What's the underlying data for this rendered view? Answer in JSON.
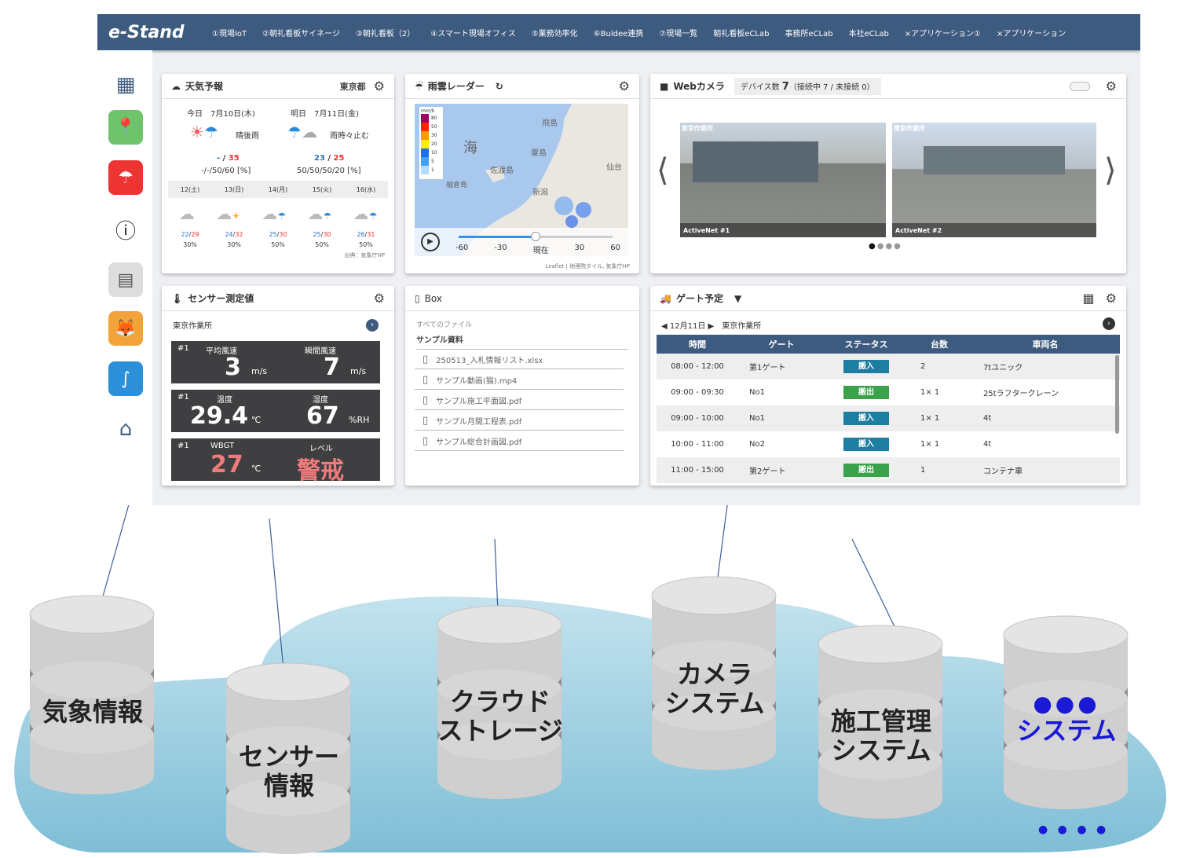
{
  "app": {
    "logo": "e-Stand",
    "nav": [
      "①現場IoT",
      "②朝礼看板サイネージ",
      "③朝礼看板（2）",
      "④スマート現場オフィス",
      "⑤業務効率化",
      "⑥Buldee連携",
      "⑦現場一覧",
      "朝礼看板eCLab",
      "事務所eCLab",
      "本社eCLab",
      "×アプリケーション①",
      "×アプリケーション"
    ]
  },
  "weather": {
    "title": "天気予報",
    "location": "東京都",
    "today_label": "今日",
    "today_date": "7月10日(木)",
    "today_cond": "晴後雨",
    "today_temp_lo": "-",
    "today_temp_hi": "35",
    "today_rain": "-/-/50/60 [%]",
    "tom_label": "明日",
    "tom_date": "7月11日(金)",
    "tom_cond": "雨時々止む",
    "tom_temp_lo": "23",
    "tom_temp_hi": "25",
    "tom_rain": "50/50/50/20 [%]",
    "days": [
      "12(土)",
      "13(日)",
      "14(月)",
      "15(火)",
      "16(水)"
    ],
    "week_temps": [
      [
        "22",
        "29"
      ],
      [
        "24",
        "32"
      ],
      [
        "25",
        "30"
      ],
      [
        "25",
        "30"
      ],
      [
        "26",
        "31"
      ]
    ],
    "week_rain": [
      "30%",
      "30%",
      "50%",
      "50%",
      "50%"
    ],
    "source": "出典：気象庁HP"
  },
  "radar": {
    "title": "雨雲レーダー",
    "sea": "海",
    "places": [
      "飛島",
      "粟島",
      "佐渡島",
      "新潟",
      "仙台",
      "舳倉島"
    ],
    "legend_unit": "mm/h",
    "legend_vals": [
      "80",
      "50",
      "30",
      "20",
      "10",
      "5",
      "1"
    ],
    "ticks": [
      "-60",
      "-30",
      "現在",
      "30",
      "60"
    ],
    "credit": "Leaflet | 地理院タイル, 気象庁HP"
  },
  "webcam": {
    "title": "Webカメラ",
    "devices_label": "デバイス数",
    "devices_count": "7",
    "devices_detail": "（接続中 7 / 未接続 0）",
    "cams": [
      {
        "site": "東京作業所",
        "name": "ActiveNet #1"
      },
      {
        "site": "東京作業所",
        "name": "ActiveNet #2"
      }
    ]
  },
  "sensor": {
    "title": "センサー測定値",
    "site": "東京作業所",
    "blocks": [
      {
        "tag": "#1",
        "l1": "平均風速",
        "v1": "3",
        "u1": "m/s",
        "l2": "瞬間風速",
        "v2": "7",
        "u2": "m/s"
      },
      {
        "tag": "#1",
        "l1": "温度",
        "v1": "29.4",
        "u1": "℃",
        "l2": "湿度",
        "v2": "67",
        "u2": "%RH"
      },
      {
        "tag": "#1",
        "l1": "WBGT",
        "v1": "27",
        "u1": "℃",
        "l2": "レベル",
        "v2": "警戒",
        "u2": ""
      }
    ]
  },
  "box": {
    "title": "Box",
    "crumb": "すべてのファイル",
    "folder": "サンプル資料",
    "files": [
      "250513_入札情報リスト.xlsx",
      "サンプル動画(猫).mp4",
      "サンプル施工平面図.pdf",
      "サンプル月間工程表.pdf",
      "サンプル総合計画図.pdf"
    ]
  },
  "gate": {
    "title": "ゲート予定",
    "date": "12月11日",
    "site": "東京作業所",
    "headers": [
      "時間",
      "ゲート",
      "ステータス",
      "台数",
      "車両名"
    ],
    "rows": [
      [
        "08:00 - 12:00",
        "第1ゲート",
        "搬入",
        "2",
        "7tユニック"
      ],
      [
        "09:00 - 09:30",
        "No1",
        "搬出",
        "1× 1",
        "25tラフタークレーン"
      ],
      [
        "09:00 - 10:00",
        "No1",
        "搬入",
        "1× 1",
        "4t"
      ],
      [
        "10:00 - 11:00",
        "No2",
        "搬入",
        "1× 1",
        "4t"
      ],
      [
        "11:00 - 15:00",
        "第2ゲート",
        "搬出",
        "1",
        "コンテナ車"
      ]
    ]
  },
  "colors": {
    "header": "#3d5a7f",
    "in": "#1e7ea1",
    "out": "#3aa24a",
    "cloud": "#a9d6e6",
    "accent_blue": "#1a1ad6"
  },
  "databases": [
    {
      "l1": "気象情報",
      "l2": ""
    },
    {
      "l1": "センサー",
      "l2": "情報"
    },
    {
      "l1": "クラウド",
      "l2": "ストレージ"
    },
    {
      "l1": "カメラ",
      "l2": "システム"
    },
    {
      "l1": "施工管理",
      "l2": "システム"
    },
    {
      "l1": "●●●",
      "l2": "システム"
    }
  ],
  "more": "● ● ● ●"
}
